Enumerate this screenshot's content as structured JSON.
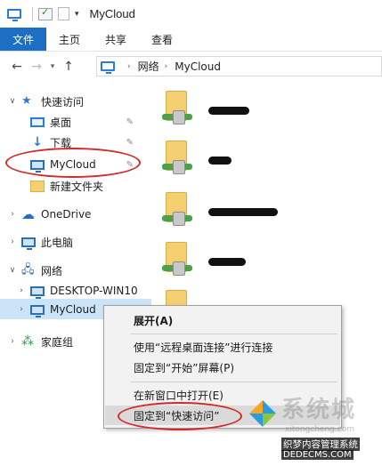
{
  "window": {
    "title": "MyCloud"
  },
  "ribbon": {
    "tabs": [
      {
        "label": "文件"
      },
      {
        "label": "主页"
      },
      {
        "label": "共享"
      },
      {
        "label": "查看"
      }
    ]
  },
  "address": {
    "crumbs": [
      "网络",
      "MyCloud"
    ]
  },
  "nav": {
    "quick_access": "快速访问",
    "desktop": "桌面",
    "downloads": "下载",
    "mycloud_pinned": "MyCloud",
    "new_folder": "新建文件夹",
    "onedrive": "OneDrive",
    "this_pc": "此电脑",
    "network": "网络",
    "desktop_pc": "DESKTOP-WIN10",
    "mycloud_net": "MyCloud",
    "homegroup": "家庭组"
  },
  "context_menu": {
    "expand": "展开(A)",
    "remote_desktop": "使用“远程桌面连接”进行连接",
    "pin_start": "固定到“开始”屏幕(P)",
    "open_new_window": "在新窗口中打开(E)",
    "pin_quick_access": "固定到“快速访问”"
  },
  "watermark": {
    "big": "系统城",
    "site": "xitongcheng.com",
    "line1": "织梦内容管理系统",
    "line2": "DEDECMS.COM"
  },
  "colors": {
    "file_tab": "#1c6fc4",
    "selection": "#cce4f7",
    "annotation": "#d12b2b"
  },
  "icons": {
    "quick_access": "star-icon",
    "desktop": "desktop-icon",
    "downloads": "download-arrow-icon",
    "pc": "monitor-icon",
    "onedrive": "cloud-icon",
    "network": "network-icon",
    "homegroup": "homegroup-icon",
    "pin": "pin-icon"
  }
}
